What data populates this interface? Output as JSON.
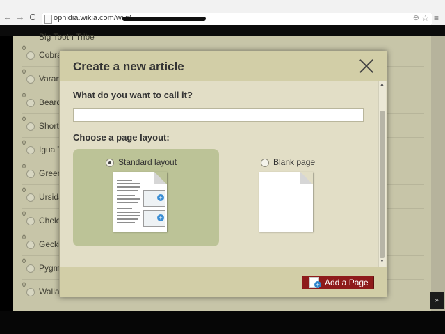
{
  "browser": {
    "url": "ophidia.wikia.com/wiki/",
    "back": "←",
    "forward": "→",
    "reload": "C",
    "star": "☆",
    "zoom": "⊕",
    "menu": "≡"
  },
  "background_list": {
    "zero": "0",
    "items": [
      "Big Tooth Tribe",
      "Cobra",
      "Varan",
      "Beard",
      "ShortT",
      "Igua T",
      "Green",
      "Ursida",
      "Chelo",
      "Gecki",
      "Pygm",
      "Walla"
    ]
  },
  "modal": {
    "title": "Create a new article",
    "question": "What do you want to call it?",
    "input_value": "",
    "layout_label": "Choose a page layout:",
    "options": [
      {
        "label": "Standard layout",
        "selected": true
      },
      {
        "label": "Blank page",
        "selected": false
      }
    ],
    "add_button": "Add a Page"
  },
  "icons": {
    "close": "close-icon",
    "doc": "document-icon",
    "scroll_up": "▲",
    "scroll_down": "▼",
    "collapse": "»"
  }
}
